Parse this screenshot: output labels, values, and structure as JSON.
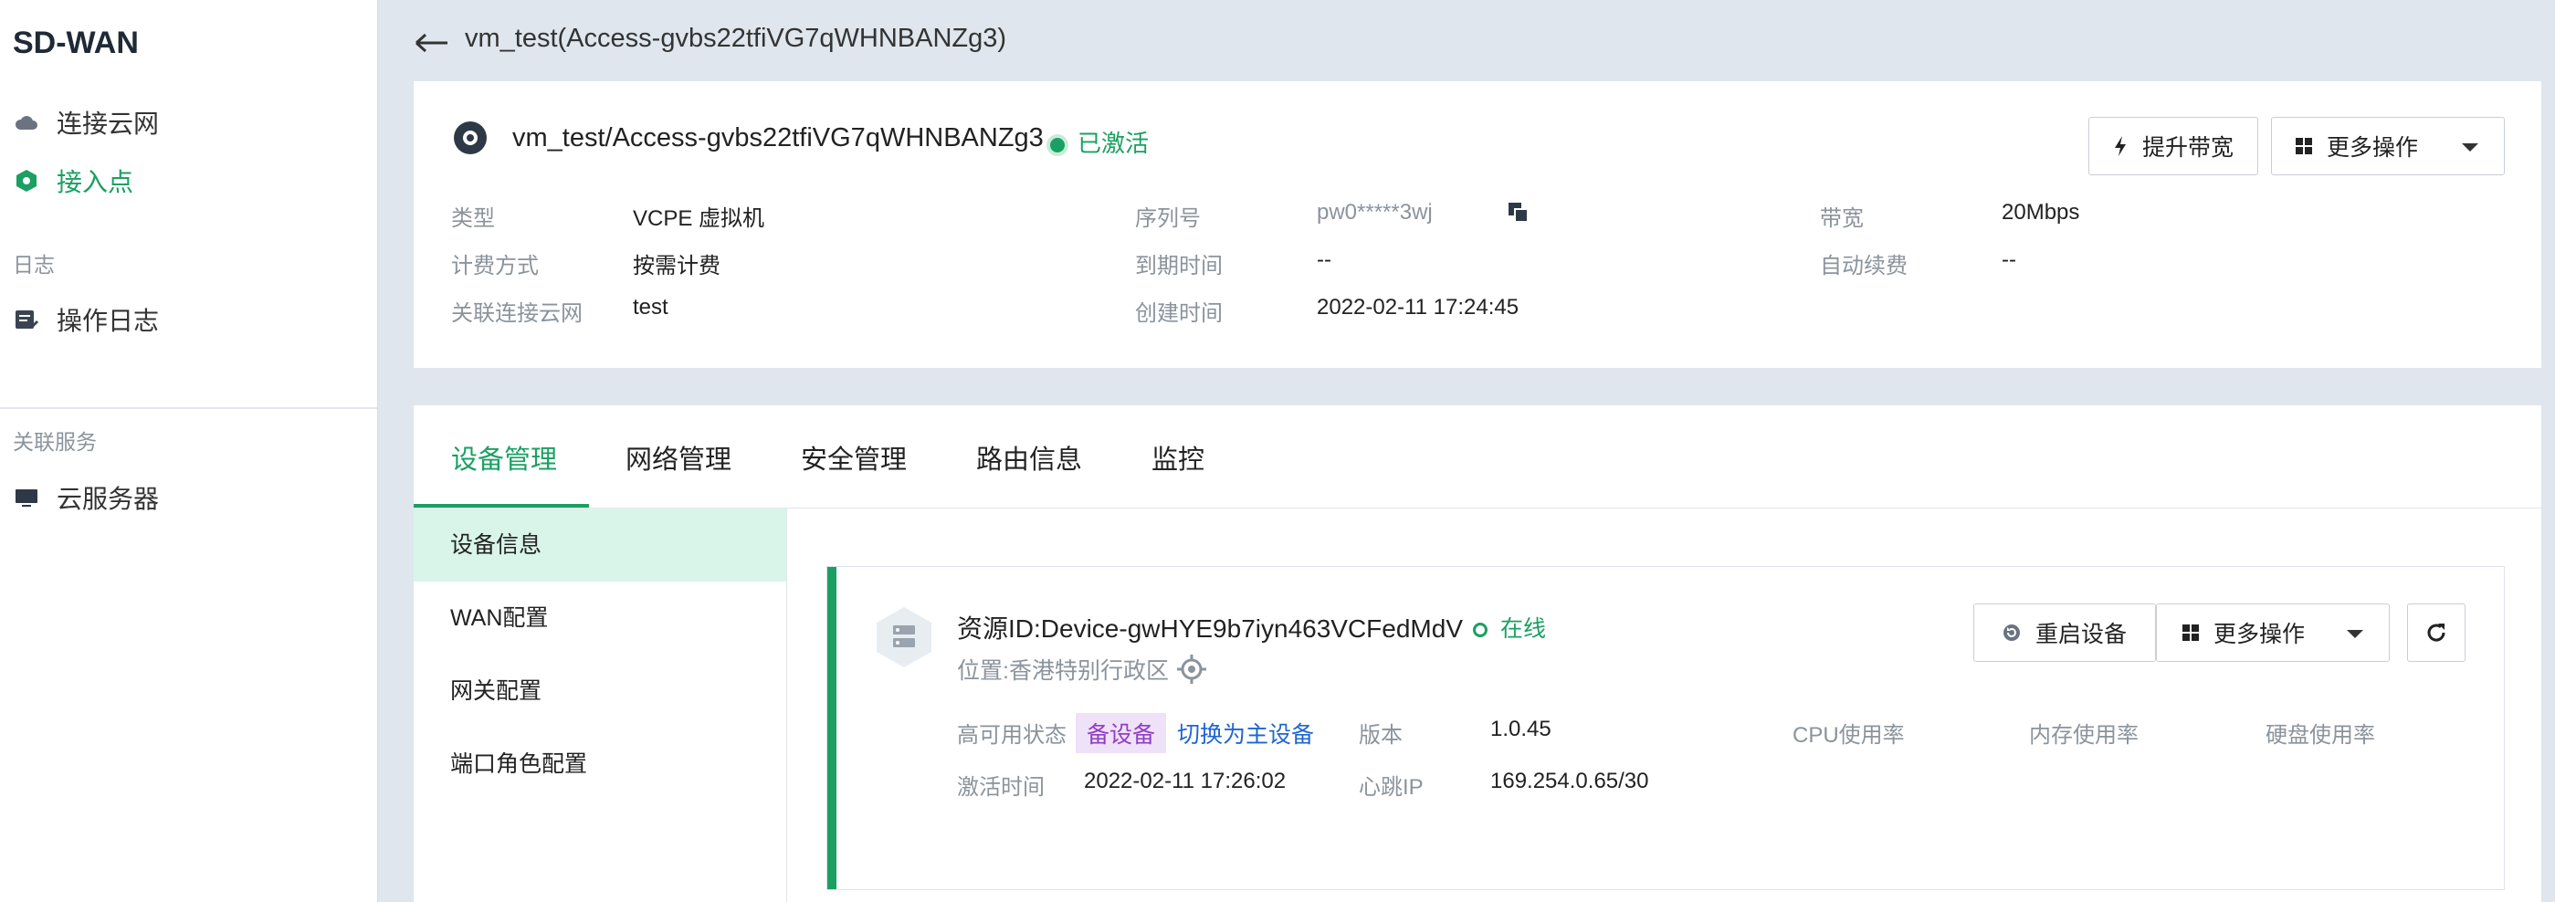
{
  "sidebar": {
    "brand": "SD-WAN",
    "items": [
      {
        "label": "连接云网",
        "icon": "cloud-icon"
      },
      {
        "label": "接入点",
        "icon": "access-point-icon"
      }
    ],
    "log_group": "日志",
    "log_item": {
      "label": "操作日志",
      "icon": "log-icon"
    },
    "related_group": "关联服务",
    "related_item": {
      "label": "云服务器",
      "icon": "monitor-icon"
    }
  },
  "header": {
    "back_icon": "arrow-left-icon",
    "title": "vm_test(Access-gvbs22tfiVG7qWHNBANZg3)"
  },
  "info": {
    "title": "vm_test/Access-gvbs22tfiVG7qWHNBANZg3",
    "status": "已激活",
    "upgrade_button": "提升带宽",
    "more_button": "更多操作",
    "fields": {
      "type_label": "类型",
      "type_value": "VCPE 虚拟机",
      "billing_label": "计费方式",
      "billing_value": "按需计费",
      "network_label": "关联连接云网",
      "network_value": "test",
      "serial_label": "序列号",
      "serial_value": "pw0*****3wj",
      "expire_label": "到期时间",
      "expire_value": "--",
      "created_label": "创建时间",
      "created_value": "2022-02-11 17:24:45",
      "bandwidth_label": "带宽",
      "bandwidth_value": "20Mbps",
      "renew_label": "自动续费",
      "renew_value": "--"
    }
  },
  "tabs": [
    "设备管理",
    "网络管理",
    "安全管理",
    "路由信息",
    "监控"
  ],
  "subnav": [
    "设备信息",
    "WAN配置",
    "网关配置",
    "端口角色配置"
  ],
  "device": {
    "title": "资源ID:Device-gwHYE9b7iyn463VCFedMdV",
    "status": "在线",
    "location": "位置:香港特别行政区",
    "restart_button": "重启设备",
    "more_button": "更多操作",
    "ha_label": "高可用状态",
    "ha_tag": "备设备",
    "ha_switch": "切换为主设备",
    "version_label": "版本",
    "version_value": "1.0.45",
    "activated_label": "激活时间",
    "activated_value": "2022-02-11 17:26:02",
    "heartbeat_label": "心跳IP",
    "heartbeat_value": "169.254.0.65/30",
    "cpu_label": "CPU使用率",
    "mem_label": "内存使用率",
    "disk_label": "硬盘使用率"
  },
  "colors": {
    "accent": "#1aa062",
    "link": "#1f66d1",
    "tag_bg": "#efe1f7",
    "tag_text": "#8f3fc2"
  }
}
